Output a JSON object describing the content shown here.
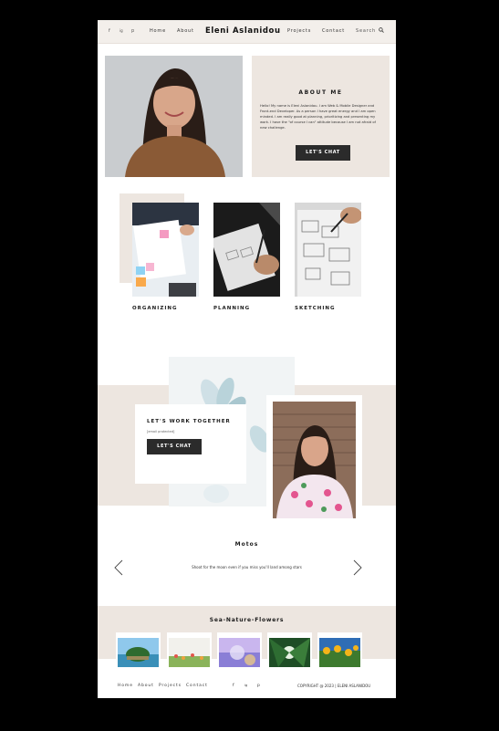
{
  "header": {
    "social": [
      "f",
      "ig",
      "p"
    ],
    "nav_left": [
      "Home",
      "About"
    ],
    "brand": "Eleni Aslanidou",
    "nav_right": [
      "Projects",
      "Contact"
    ],
    "search_label": "Search"
  },
  "about": {
    "title": "ABOUT ME",
    "text": "Hello! My name is Eleni Aslanidou. I am Web & Mobile Designer and Front-end Developer. As a person I have great energy and I am open minded. I am really good at planning, prioritizing and presenting my work. I have the \"of course I can\" attitude because I am not afraid of new challenge.",
    "cta": "LET'S CHAT"
  },
  "process": [
    {
      "label": "ORGANIZING"
    },
    {
      "label": "PLANNING"
    },
    {
      "label": "SKETCHING"
    }
  ],
  "work": {
    "title": "LET'S WORK TOGETHER",
    "email": "[email protected]",
    "cta": "LET'S CHAT"
  },
  "mottos": {
    "title": "Motos",
    "text": "Shoot for the moon even if you miss you'll land among stars"
  },
  "gallery": {
    "title": "Sea-Nature-Flowers",
    "items": [
      "sea-island",
      "flower-field",
      "bokeh-light",
      "forest-canopy",
      "yellow-flowers"
    ]
  },
  "footer": {
    "links": [
      "Home",
      "About",
      "Projects",
      "Contact"
    ],
    "social": [
      "f",
      "ig",
      "p"
    ],
    "copyright": "COPYRIGHT @ 2023 | ELENI ASLANIDOU"
  },
  "colors": {
    "accent_bg": "#ede6e0",
    "button": "#2b2b2b",
    "frame": "#000000"
  }
}
